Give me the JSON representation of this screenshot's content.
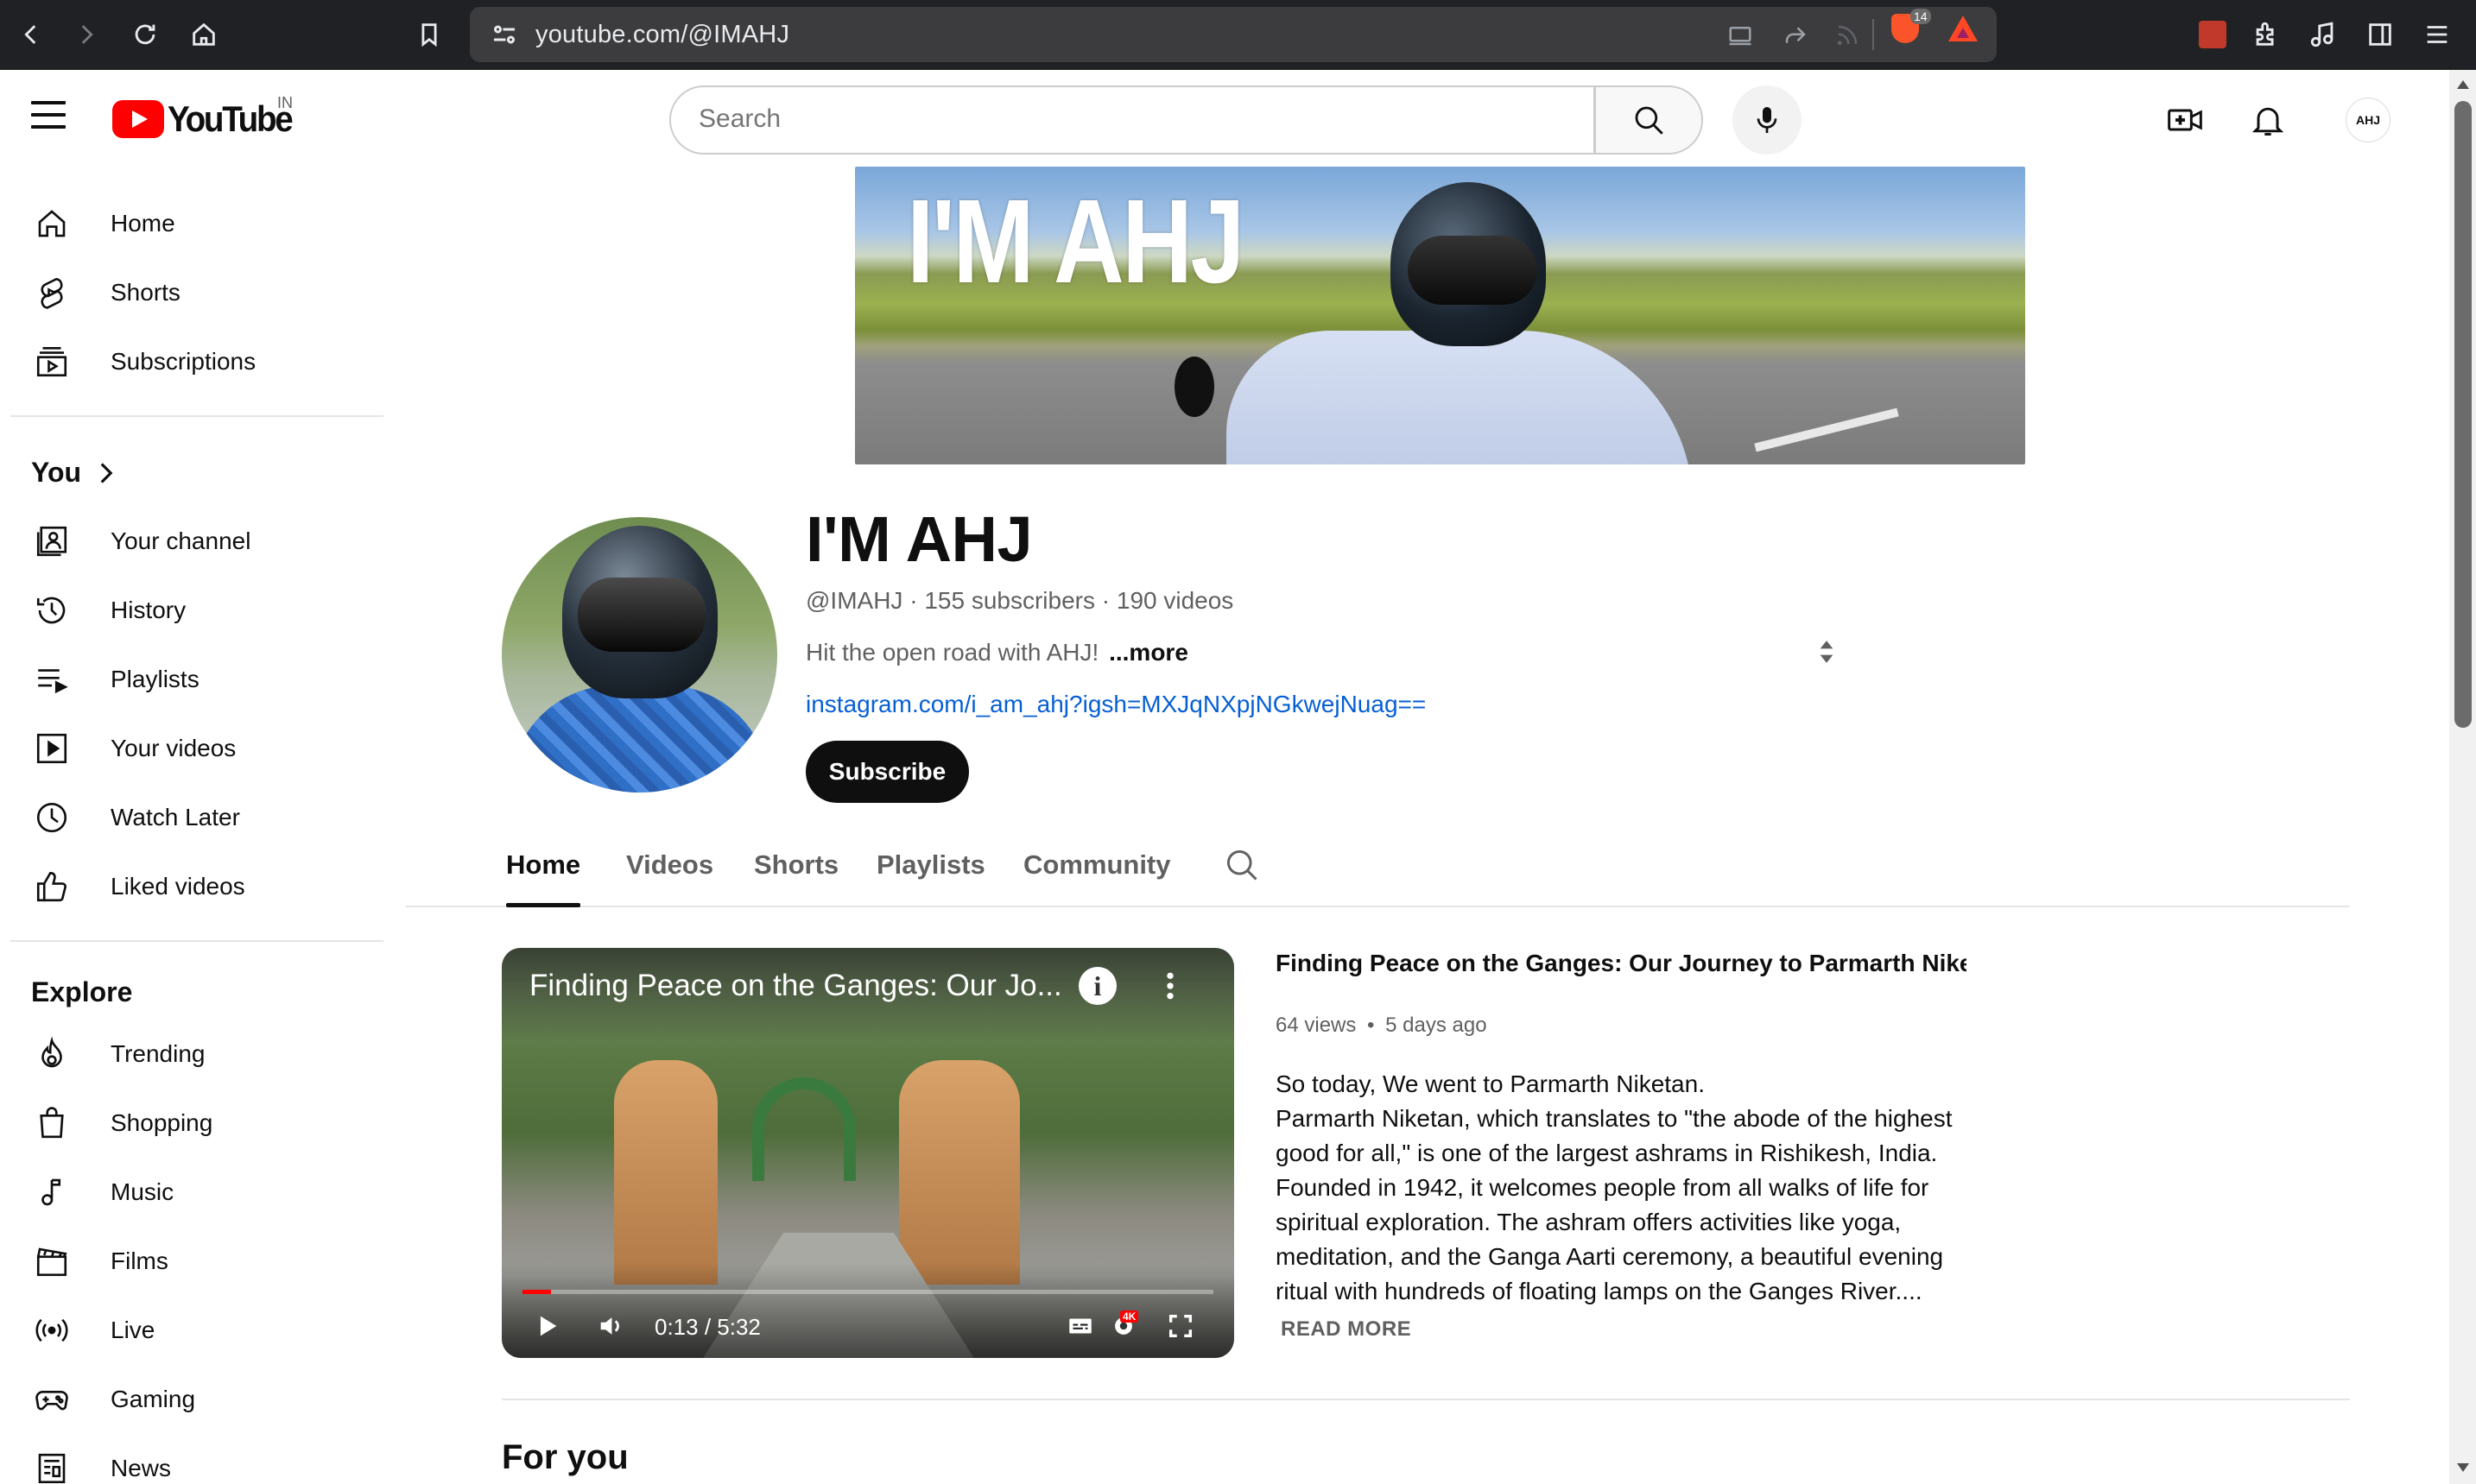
{
  "browser": {
    "url": "youtube.com/@IMAHJ",
    "brave_shield_count": "14"
  },
  "masthead": {
    "logo_text": "YouTube",
    "country_code": "IN",
    "search_placeholder": "Search",
    "avatar_initials": "AHJ"
  },
  "sidebar": {
    "top_items": [
      {
        "label": "Home",
        "icon": "home-icon"
      },
      {
        "label": "Shorts",
        "icon": "shorts-icon"
      },
      {
        "label": "Subscriptions",
        "icon": "subscriptions-icon"
      }
    ],
    "you_heading": "You",
    "you_items": [
      {
        "label": "Your channel",
        "icon": "your-channel-icon"
      },
      {
        "label": "History",
        "icon": "history-icon"
      },
      {
        "label": "Playlists",
        "icon": "playlists-icon"
      },
      {
        "label": "Your videos",
        "icon": "your-videos-icon"
      },
      {
        "label": "Watch Later",
        "icon": "clock-icon"
      },
      {
        "label": "Liked videos",
        "icon": "thumbs-up-icon"
      }
    ],
    "explore_heading": "Explore",
    "explore_items": [
      {
        "label": "Trending",
        "icon": "flame-icon"
      },
      {
        "label": "Shopping",
        "icon": "shopping-bag-icon"
      },
      {
        "label": "Music",
        "icon": "music-note-icon"
      },
      {
        "label": "Films",
        "icon": "clapperboard-icon"
      },
      {
        "label": "Live",
        "icon": "live-icon"
      },
      {
        "label": "Gaming",
        "icon": "gamepad-icon"
      },
      {
        "label": "News",
        "icon": "news-icon"
      }
    ]
  },
  "channel": {
    "banner_text": "I'M AHJ",
    "name": "I'M AHJ",
    "handle": "@IMAHJ",
    "subscribers": "155 subscribers",
    "videos": "190 videos",
    "separator": "·",
    "description": "Hit the open road with AHJ!",
    "more_label": "...more",
    "link": "instagram.com/i_am_ahj?igsh=MXJqNXpjNGkwejNuag==",
    "subscribe_label": "Subscribe"
  },
  "tabs": [
    {
      "label": "Home",
      "active": true
    },
    {
      "label": "Videos",
      "active": false
    },
    {
      "label": "Shorts",
      "active": false
    },
    {
      "label": "Playlists",
      "active": false
    },
    {
      "label": "Community",
      "active": false
    }
  ],
  "featured_video": {
    "player_title": "Finding Peace on the Ganges: Our Jo...",
    "title": "Finding Peace on the Ganges: Our Journey to Parmarth Niketa...",
    "views": "64 views",
    "age": "5 days ago",
    "meta_separator": "•",
    "description": "So today, We went to Parmarth Niketan.\nParmarth Niketan, which translates to \"the abode of the highest good for all,\" is one of the largest ashrams in Rishikesh, India. Founded in 1942, it welcomes people from all walks of life for spiritual exploration. The ashram offers activities like yoga, meditation, and the Ganga Aarti ceremony, a beautiful evening ritual with hundreds of floating lamps on the Ganges River....",
    "read_more_label": "READ MORE",
    "time": "0:13 / 5:32",
    "progress_fraction": 0.041,
    "quality_badge": "4K"
  },
  "section": {
    "for_you": "For you"
  },
  "colors": {
    "youtube_red": "#ff0000",
    "link_blue": "#065fd4",
    "chrome_dark": "#202124"
  }
}
